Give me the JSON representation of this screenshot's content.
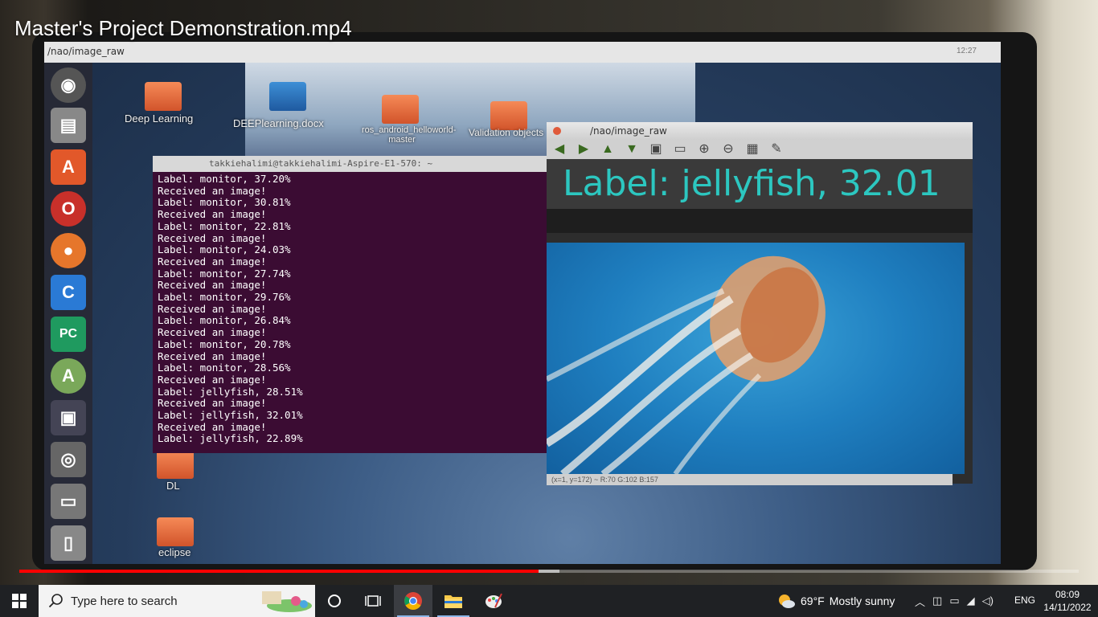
{
  "video": {
    "title": "Master's Project Demonstration.mp4",
    "progress": 0.49,
    "buffered": 0.51
  },
  "screen": {
    "topbar_title": "/nao/image_raw",
    "topbar_clock": "12:27",
    "desktop_icons": [
      {
        "label": "Deep Learning"
      },
      {
        "label": "DEEPlearning.docx"
      },
      {
        "label": "ros_android_helloworld-master"
      },
      {
        "label": "Validation objects"
      },
      {
        "label": "DL"
      },
      {
        "label": "eclipse"
      }
    ],
    "launcher": [
      "ubuntu-icon",
      "files-icon",
      "software-icon",
      "opera-icon",
      "firefox-icon",
      "clion-icon",
      "pycharm-icon",
      "android-studio-icon",
      "lock-icon",
      "screenshot-icon",
      "printer-icon",
      "trash-icon"
    ],
    "terminal": {
      "title": "takkiehalimi@takkiehalimi-Aspire-E1-570: ~",
      "lines": [
        "Label: monitor, 37.20%",
        "Received an image!",
        "Label: monitor, 30.81%",
        "Received an image!",
        "Label: monitor, 22.81%",
        "Received an image!",
        "Label: monitor, 24.03%",
        "Received an image!",
        "Label: monitor, 27.74%",
        "Received an image!",
        "Label: monitor, 29.76%",
        "Received an image!",
        "Label: monitor, 26.84%",
        "Received an image!",
        "Label: monitor, 20.78%",
        "Received an image!",
        "Label: monitor, 28.56%",
        "Received an image!",
        "Label: jellyfish, 28.51%",
        "Received an image!",
        "Label: jellyfish, 32.01%",
        "Received an image!",
        "Label: jellyfish, 22.89%"
      ]
    },
    "viewer": {
      "title": "/nao/image_raw",
      "overlay_label": "Label: jellyfish, 32.01",
      "status": "(x=1, y=172) ~ R:70 G:102 B:157"
    }
  },
  "taskbar": {
    "search_placeholder": "Type here to search",
    "weather_temp": "69°F",
    "weather_text": "Mostly sunny",
    "language": "ENG",
    "time": "08:09",
    "date": "14/11/2022"
  },
  "colors": {
    "progress_played": "#ff0000",
    "terminal_bg": "#3b0c33",
    "label_text": "#2cc7c0",
    "taskbar_bg": "#1f2124"
  }
}
